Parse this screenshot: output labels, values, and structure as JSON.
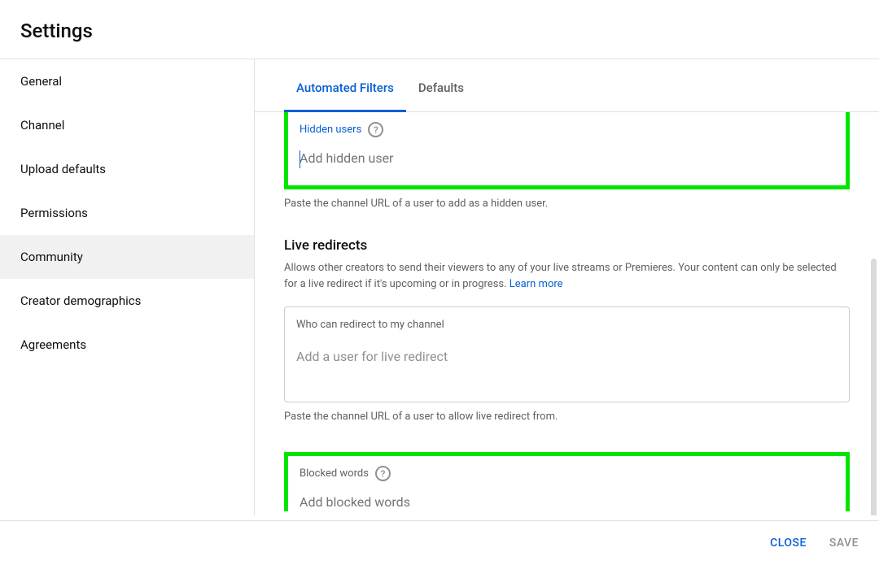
{
  "header": {
    "title": "Settings"
  },
  "sidebar": {
    "items": [
      {
        "label": "General"
      },
      {
        "label": "Channel"
      },
      {
        "label": "Upload defaults"
      },
      {
        "label": "Permissions"
      },
      {
        "label": "Community"
      },
      {
        "label": "Creator demographics"
      },
      {
        "label": "Agreements"
      }
    ]
  },
  "tabs": {
    "items": [
      {
        "label": "Automated Filters"
      },
      {
        "label": "Defaults"
      }
    ]
  },
  "hidden_users": {
    "label": "Hidden users",
    "placeholder": "Add hidden user",
    "helper": "Paste the channel URL of a user to add as a hidden user."
  },
  "live_redirects": {
    "title": "Live redirects",
    "description": "Allows other creators to send their viewers to any of your live streams or Premieres. Your content can only be selected for a live redirect if it's upcoming or in progress. ",
    "learn_more": "Learn more",
    "box_label": "Who can redirect to my channel",
    "box_placeholder": "Add a user for live redirect",
    "helper": "Paste the channel URL of a user to allow live redirect from."
  },
  "blocked_words": {
    "label": "Blocked words",
    "placeholder": "Add blocked words"
  },
  "footer": {
    "close": "CLOSE",
    "save": "SAVE"
  }
}
